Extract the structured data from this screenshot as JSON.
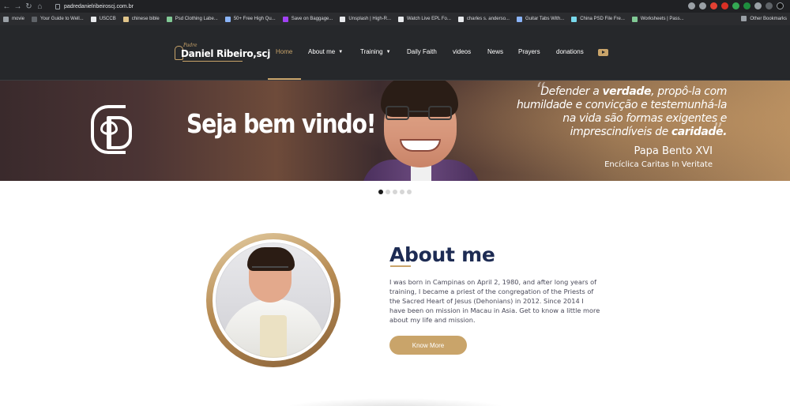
{
  "browser": {
    "url": "padredanielribeiroscj.com.br",
    "bookmarks": [
      {
        "label": "movie",
        "color": "#9aa0a6"
      },
      {
        "label": "Your Guide to Well...",
        "color": "#5f6368"
      },
      {
        "label": "USCCB",
        "color": "#e8eaed"
      },
      {
        "label": "chinese bible",
        "color": "#e0c48a"
      },
      {
        "label": "Psd Clothing Labe...",
        "color": "#81c995"
      },
      {
        "label": "50+ Free High Qu...",
        "color": "#8ab4f8"
      },
      {
        "label": "Save on Baggage...",
        "color": "#a142f4"
      },
      {
        "label": "Unsplash | High-R...",
        "color": "#e8eaed"
      },
      {
        "label": "Watch Live EPL Fo...",
        "color": "#e8eaed"
      },
      {
        "label": "charles s. anderso...",
        "color": "#e8eaed"
      },
      {
        "label": "Guitar Tabs With...",
        "color": "#8ab4f8"
      },
      {
        "label": "China PSD File Fre...",
        "color": "#78d9ec"
      },
      {
        "label": "Worksheets | Pass...",
        "color": "#81c995"
      }
    ],
    "other_bookmarks": "Other Bookmarks"
  },
  "header": {
    "logo_small": "Padre",
    "logo_big": "Daniel Ribeiro,scj",
    "menu": {
      "home": "Home",
      "about": "About me",
      "training": "Training",
      "daily_faith": "Daily Faith",
      "videos": "videos",
      "news": "News",
      "prayers": "Prayers",
      "donations": "donations"
    },
    "accent_color": "#c9a46a"
  },
  "hero": {
    "welcome": "Seja bem vindo!",
    "quote_line1_pre": "Defender a ",
    "quote_line1_bold": "verdade",
    "quote_line1_post": ", propô-la com",
    "quote_line2": "humildade e convicção e testemunhá-la",
    "quote_line3": "na vida são formas exigentes e",
    "quote_line4_pre": "imprescindíveis de ",
    "quote_line4_bold": "caridade.",
    "author": "Papa Bento XVI",
    "source": "Encíclica Caritas In Veritate",
    "slides_total": 5,
    "active_slide": 1
  },
  "about": {
    "title": "About me",
    "text": "I was born in Campinas on April 2, 1980, and after long years of training, I became a priest of the congregation of the Priests of the Sacred Heart of Jesus (Dehonians) in 2012. Since 2014 I have been on mission in Macau in Asia. Get to know a little more about my life and mission.",
    "button": "Know More",
    "title_color": "#1d2b53"
  }
}
